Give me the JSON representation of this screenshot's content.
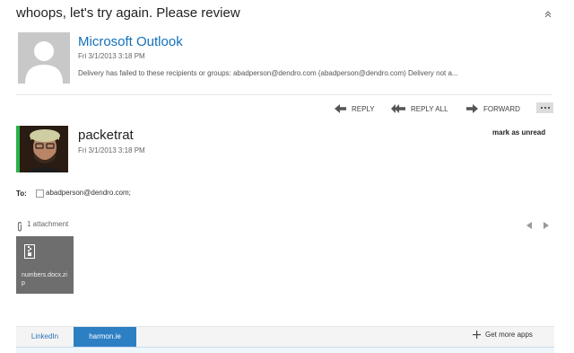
{
  "subject": "whoops, let's try again. Please review",
  "messages": [
    {
      "sender": "Microsoft Outlook",
      "date": "Fri 3/1/2013 3:18 PM",
      "preview": "Delivery has failed to these recipients or groups: abadperson@dendro.com (abadperson@dendro.com) Delivery not a...",
      "avatar": "default-person-icon"
    },
    {
      "sender": "packetrat",
      "date": "Fri 3/1/2013 3:18 PM",
      "avatar": "user-photo",
      "presence_color": "#2bb24c",
      "mark_unread": "mark as unread",
      "to_label": "To:",
      "recipient": "abadperson@dendro.com;",
      "attachment_count": "1 attachment",
      "attachments": [
        {
          "name": "numbers.docx.zip",
          "icon": "zip-file-icon"
        }
      ]
    }
  ],
  "actions": {
    "reply": "REPLY",
    "reply_all": "REPLY ALL",
    "forward": "FORWARD",
    "more_icon": "ellipsis-icon"
  },
  "apps": {
    "tabs": [
      {
        "label": "LinkedIn",
        "active": false
      },
      {
        "label": "harmon.ie",
        "active": true
      }
    ],
    "get_more": "Get more apps"
  },
  "colors": {
    "link_blue": "#1570b8",
    "active_tab": "#2d7fc4",
    "attachment_tile": "#6e6e6e"
  }
}
